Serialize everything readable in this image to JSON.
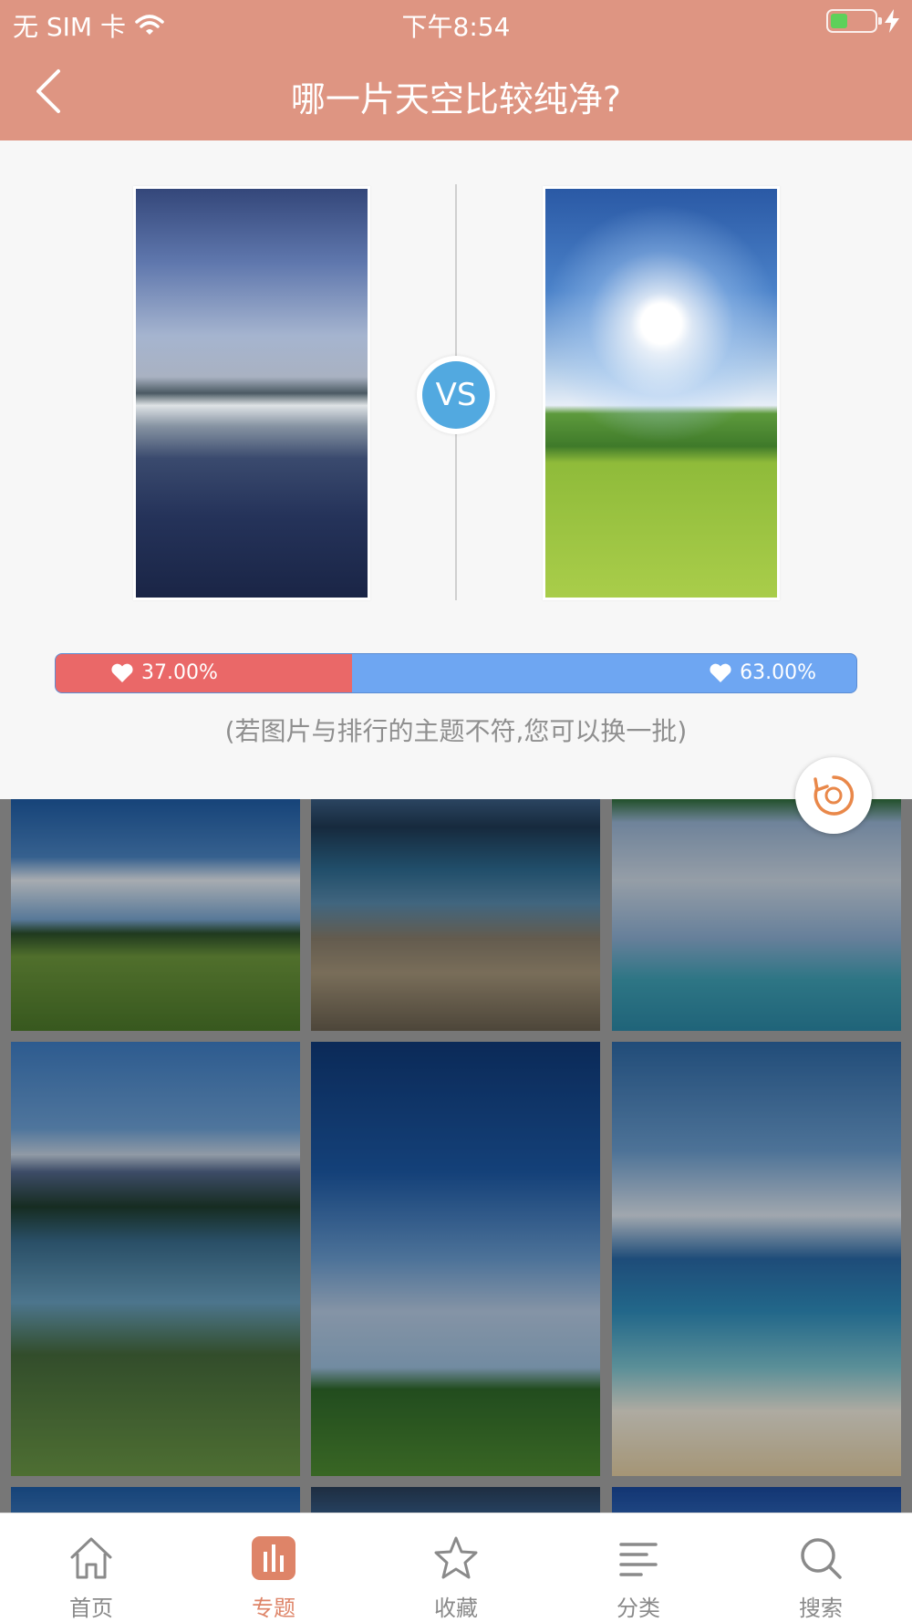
{
  "status_bar": {
    "carrier": "无 SIM 卡",
    "time": "下午8:54",
    "battery_level": 0.4
  },
  "nav": {
    "back_icon": "chevron-left-icon",
    "title": "哪一片天空比较纯净?"
  },
  "compare": {
    "vs_label": "VS",
    "left_percent_label": "37.00%",
    "right_percent_label": "63.00%",
    "left_share": 0.37,
    "hint": "(若图片与排行的主题不符,您可以换一批)"
  },
  "colors": {
    "header": "#de9582",
    "vs_badge": "#52a9e0",
    "left_vote": "#ea6868",
    "right_vote": "#6ea6f2",
    "accent": "#de8468"
  },
  "tabs": [
    {
      "label": "首页",
      "icon": "home-icon",
      "active": false
    },
    {
      "label": "专题",
      "icon": "bar-chart-icon",
      "active": true
    },
    {
      "label": "收藏",
      "icon": "star-icon",
      "active": false
    },
    {
      "label": "分类",
      "icon": "list-icon",
      "active": false
    },
    {
      "label": "搜索",
      "icon": "search-icon",
      "active": false
    }
  ]
}
